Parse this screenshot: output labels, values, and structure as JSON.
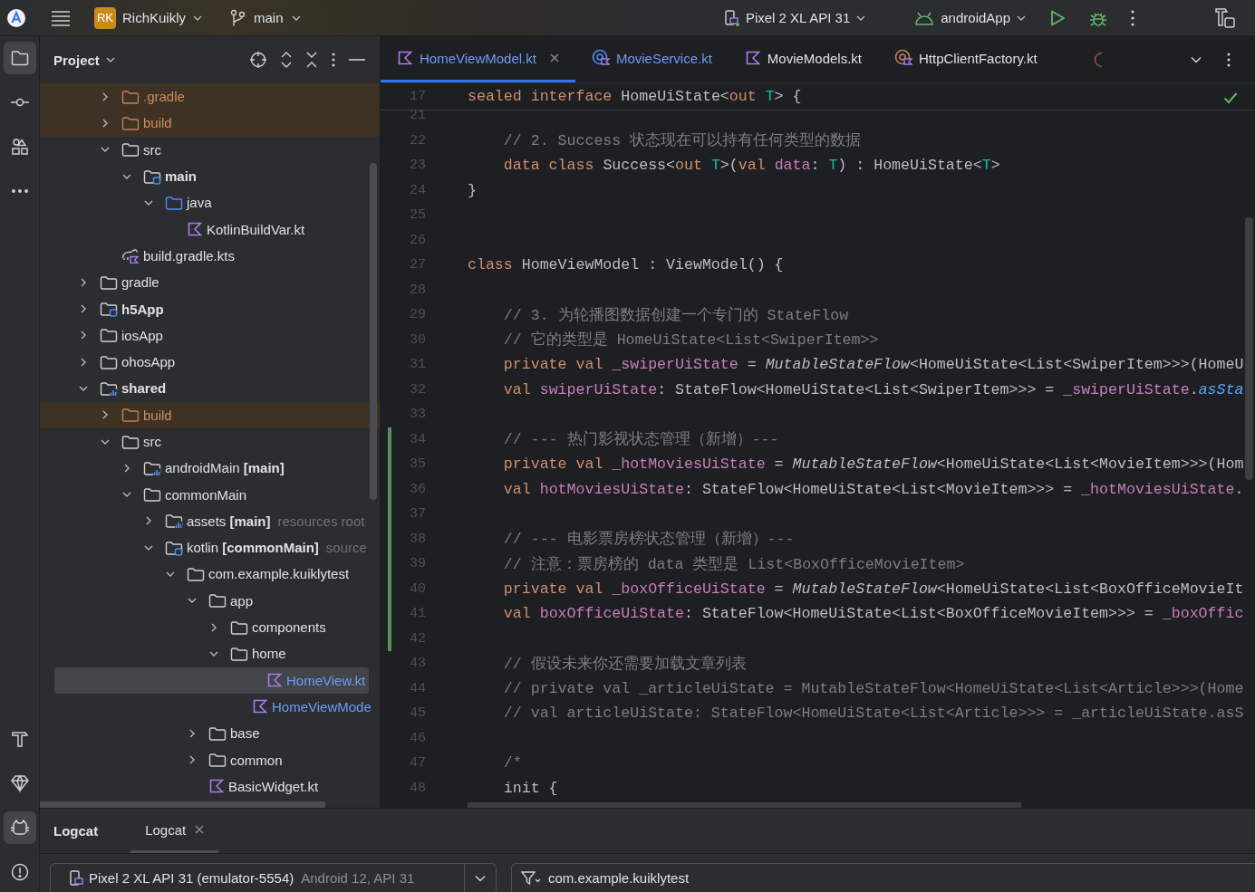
{
  "top_bar": {
    "project": {
      "badge": "RK",
      "name": "RichKuikly"
    },
    "branch": "main",
    "device": "Pixel 2 XL API 31",
    "run_config": "androidApp"
  },
  "tool_strip": {
    "top": [
      {
        "kind": "project",
        "selected": true
      },
      {
        "kind": "commit",
        "selected": false
      },
      {
        "kind": "structure",
        "selected": false
      },
      {
        "kind": "more",
        "selected": false
      }
    ],
    "bottom": [
      {
        "kind": "build",
        "selected": false
      },
      {
        "kind": "gem",
        "selected": false
      },
      {
        "kind": "logcat",
        "selected": true
      },
      {
        "kind": "problems",
        "selected": false
      }
    ]
  },
  "project_panel": {
    "title": "Project",
    "tree": {
      "continued": [
        {
          "label": ".gradle",
          "kind": "excluded-folder",
          "expanded": false,
          "selected": false
        },
        {
          "label": "build",
          "kind": "excluded-folder",
          "expanded": false,
          "selected": false
        },
        {
          "label": "src",
          "kind": "folder",
          "expanded": true,
          "selected": false,
          "children": [
            {
              "label": "main",
              "kind": "module-folder",
              "bold": true,
              "expanded": true,
              "selected": false,
              "children": [
                {
                  "label": "java",
                  "kind": "source-folder",
                  "expanded": true,
                  "selected": false,
                  "children": [
                    {
                      "label": "KotlinBuildVar.kt",
                      "kind": "kotlin-file",
                      "changed": false,
                      "selected": false
                    }
                  ]
                }
              ]
            }
          ]
        },
        {
          "label": "build.gradle.kts",
          "kind": "gradle-script",
          "selected": false
        }
      ],
      "items": [
        {
          "label": "gradle",
          "kind": "folder",
          "expanded": false,
          "selected": false
        },
        {
          "label": "h5App",
          "kind": "module-folder",
          "bold": true,
          "expanded": false,
          "selected": false
        },
        {
          "label": "iosApp",
          "kind": "folder",
          "expanded": false,
          "selected": false
        },
        {
          "label": "ohosApp",
          "kind": "folder",
          "expanded": false,
          "selected": false
        },
        {
          "label": "shared",
          "kind": "library-folder",
          "bold": true,
          "expanded": true,
          "selected": false,
          "children": [
            {
              "label": "build",
              "kind": "excluded-folder",
              "expanded": false,
              "selected": false
            },
            {
              "label": "src",
              "kind": "folder",
              "expanded": true,
              "selected": false,
              "children": [
                {
                  "label": "androidMain **[main]**",
                  "kind": "library-folder",
                  "bold": false,
                  "expanded": false,
                  "selected": false
                },
                {
                  "label": "commonMain",
                  "kind": "folder",
                  "expanded": true,
                  "selected": false,
                  "children": [
                    {
                      "label": "assets **[main]**",
                      "hint": "resources root",
                      "kind": "library-folder",
                      "bold": false,
                      "expanded": false,
                      "selected": false
                    },
                    {
                      "label": "kotlin **[commonMain]**",
                      "hint": "source",
                      "kind": "module-folder",
                      "bold": false,
                      "expanded": true,
                      "selected": false,
                      "children": [
                        {
                          "label": "com.example.kuiklytest",
                          "kind": "folder",
                          "expanded": true,
                          "selected": false,
                          "children": [
                            {
                              "label": "app",
                              "kind": "folder",
                              "expanded": true,
                              "selected": false,
                              "children": [
                                {
                                  "label": "components",
                                  "kind": "folder",
                                  "expanded": false,
                                  "selected": false
                                },
                                {
                                  "label": "home",
                                  "kind": "folder",
                                  "expanded": true,
                                  "selected": false,
                                  "children": [
                                    {
                                      "label": "HomeView.kt",
                                      "kind": "kotlin-file",
                                      "changed": true,
                                      "selected": true
                                    },
                                    {
                                      "label": "HomeViewMode",
                                      "kind": "kotlin-file",
                                      "changed": true,
                                      "selected": false
                                    }
                                  ]
                                }
                              ]
                            },
                            {
                              "label": "base",
                              "kind": "folder",
                              "expanded": false,
                              "selected": false
                            },
                            {
                              "label": "common",
                              "kind": "folder",
                              "expanded": false,
                              "selected": false
                            },
                            {
                              "label": "BasicWidget.kt",
                              "kind": "kotlin-file",
                              "changed": false,
                              "selected": false
                            }
                          ]
                        }
                      ]
                    }
                  ]
                }
              ]
            }
          ]
        }
      ]
    }
  },
  "editor": {
    "tabs": [
      {
        "label": "HomeViewModel.kt",
        "kind": "kotlin",
        "changed": true,
        "selected": true
      },
      {
        "label": "MovieService.kt",
        "kind": "service",
        "changed": true,
        "selected": false
      },
      {
        "label": "MovieModels.kt",
        "kind": "kotlin",
        "changed": false,
        "selected": false
      },
      {
        "label": "HttpClientFactory.kt",
        "kind": "client",
        "changed": false,
        "selected": false
      }
    ],
    "sticky_line": {
      "number": "17",
      "tokens": [
        {
          "kind": "keyword",
          "text": "sealed interface "
        },
        {
          "kind": "plain",
          "text": "HomeUiState<"
        },
        {
          "kind": "keyword",
          "text": "out "
        },
        {
          "kind": "type-param",
          "text": "T"
        },
        {
          "kind": "plain",
          "text": "> {"
        }
      ]
    },
    "lines": [
      {
        "number": "21",
        "changed": false
      },
      {
        "number": "22",
        "changed": false,
        "tokens": [
          {
            "kind": "comment",
            "text": "    // 2. Success 状态现在可以持有任何类型的数据"
          }
        ]
      },
      {
        "number": "23",
        "changed": false,
        "tokens": [
          {
            "kind": "keyword",
            "text": "    data class "
          },
          {
            "kind": "plain",
            "text": "Success<"
          },
          {
            "kind": "keyword",
            "text": "out "
          },
          {
            "kind": "type-param",
            "text": "T"
          },
          {
            "kind": "plain",
            "text": ">("
          },
          {
            "kind": "keyword",
            "text": "val "
          },
          {
            "kind": "property",
            "text": "data"
          },
          {
            "kind": "plain",
            "text": ": "
          },
          {
            "kind": "type-param",
            "text": "T"
          },
          {
            "kind": "plain",
            "text": ") : HomeUiState<"
          },
          {
            "kind": "type-param",
            "text": "T"
          },
          {
            "kind": "plain",
            "text": ">"
          }
        ]
      },
      {
        "number": "24",
        "changed": false,
        "tokens": [
          {
            "kind": "plain",
            "text": "}"
          }
        ]
      },
      {
        "number": "25",
        "changed": false
      },
      {
        "number": "26",
        "changed": false
      },
      {
        "number": "27",
        "changed": false,
        "tokens": [
          {
            "kind": "keyword",
            "text": "class "
          },
          {
            "kind": "plain",
            "text": "HomeViewModel : ViewModel() {"
          }
        ]
      },
      {
        "number": "28",
        "changed": false
      },
      {
        "number": "29",
        "changed": false,
        "tokens": [
          {
            "kind": "comment",
            "text": "    // 3. 为轮播图数据创建一个专门的 StateFlow"
          }
        ]
      },
      {
        "number": "30",
        "changed": false,
        "tokens": [
          {
            "kind": "comment",
            "text": "    // 它的类型是 HomeUiState<List<SwiperItem>>"
          }
        ]
      },
      {
        "number": "31",
        "changed": false,
        "tokens": [
          {
            "kind": "keyword",
            "text": "    private val "
          },
          {
            "kind": "property",
            "text": "_swiperUiState"
          },
          {
            "kind": "plain",
            "text": " = "
          },
          {
            "kind": "call",
            "text": "MutableStateFlow"
          },
          {
            "kind": "plain",
            "text": "<HomeUiState<List<SwiperItem>>>(HomeU"
          }
        ]
      },
      {
        "number": "32",
        "changed": false,
        "tokens": [
          {
            "kind": "keyword",
            "text": "    val "
          },
          {
            "kind": "property",
            "text": "swiperUiState"
          },
          {
            "kind": "plain",
            "text": ": StateFlow<HomeUiState<List<SwiperItem>>> = "
          },
          {
            "kind": "property",
            "text": "_swiperUiState"
          },
          {
            "kind": "plain",
            "text": "."
          },
          {
            "kind": "extension",
            "text": "asSta"
          }
        ]
      },
      {
        "number": "33",
        "changed": false
      },
      {
        "number": "34",
        "changed": true,
        "tokens": [
          {
            "kind": "comment",
            "text": "    // --- 热门影视状态管理（新增）---"
          }
        ]
      },
      {
        "number": "35",
        "changed": true,
        "tokens": [
          {
            "kind": "keyword",
            "text": "    private val "
          },
          {
            "kind": "property",
            "text": "_hotMoviesUiState"
          },
          {
            "kind": "plain",
            "text": " = "
          },
          {
            "kind": "call",
            "text": "MutableStateFlow"
          },
          {
            "kind": "plain",
            "text": "<HomeUiState<List<MovieItem>>>(Hom"
          }
        ]
      },
      {
        "number": "36",
        "changed": true,
        "tokens": [
          {
            "kind": "keyword",
            "text": "    val "
          },
          {
            "kind": "property",
            "text": "hotMoviesUiState"
          },
          {
            "kind": "plain",
            "text": ": StateFlow<HomeUiState<List<MovieItem>>> = "
          },
          {
            "kind": "property",
            "text": "_hotMoviesUiState"
          },
          {
            "kind": "plain",
            "text": "."
          }
        ]
      },
      {
        "number": "37",
        "changed": true
      },
      {
        "number": "38",
        "changed": true,
        "tokens": [
          {
            "kind": "comment",
            "text": "    // --- 电影票房榜状态管理（新增）---"
          }
        ]
      },
      {
        "number": "39",
        "changed": true,
        "tokens": [
          {
            "kind": "comment",
            "text": "    // 注意：票房榜的 data 类型是 List<BoxOfficeMovieItem>"
          }
        ]
      },
      {
        "number": "40",
        "changed": true,
        "tokens": [
          {
            "kind": "keyword",
            "text": "    private val "
          },
          {
            "kind": "property",
            "text": "_boxOfficeUiState"
          },
          {
            "kind": "plain",
            "text": " = "
          },
          {
            "kind": "call",
            "text": "MutableStateFlow"
          },
          {
            "kind": "plain",
            "text": "<HomeUiState<List<BoxOfficeMovieIt"
          }
        ]
      },
      {
        "number": "41",
        "changed": true,
        "tokens": [
          {
            "kind": "keyword",
            "text": "    val "
          },
          {
            "kind": "property",
            "text": "boxOfficeUiState"
          },
          {
            "kind": "plain",
            "text": ": StateFlow<HomeUiState<List<BoxOfficeMovieItem>>> = "
          },
          {
            "kind": "property",
            "text": "_boxOffic"
          }
        ]
      },
      {
        "number": "42",
        "changed": true
      },
      {
        "number": "43",
        "changed": false,
        "tokens": [
          {
            "kind": "comment",
            "text": "    // 假设未来你还需要加载文章列表"
          }
        ]
      },
      {
        "number": "44",
        "changed": false,
        "tokens": [
          {
            "kind": "comment",
            "text": "    // private val _articleUiState = MutableStateFlow<HomeUiState<List<Article>>>(Home"
          }
        ]
      },
      {
        "number": "45",
        "changed": false,
        "tokens": [
          {
            "kind": "comment",
            "text": "    // val articleUiState: StateFlow<HomeUiState<List<Article>>> = _articleUiState.asS"
          }
        ]
      },
      {
        "number": "46",
        "changed": false
      },
      {
        "number": "47",
        "changed": false,
        "tokens": [
          {
            "kind": "comment",
            "text": "    /*"
          }
        ]
      },
      {
        "number": "48",
        "changed": false,
        "tokens": [
          {
            "kind": "plain",
            "text": "    init {"
          }
        ]
      }
    ]
  },
  "bottom_panel": {
    "title": "Logcat",
    "tabs": [
      {
        "label": "Logcat",
        "selected": true
      }
    ],
    "device": {
      "name": "Pixel 2 XL API 31 (emulator-5554)",
      "detail": "Android 12, API 31"
    },
    "filter": {
      "value": "com.example.kuiklytest"
    }
  }
}
